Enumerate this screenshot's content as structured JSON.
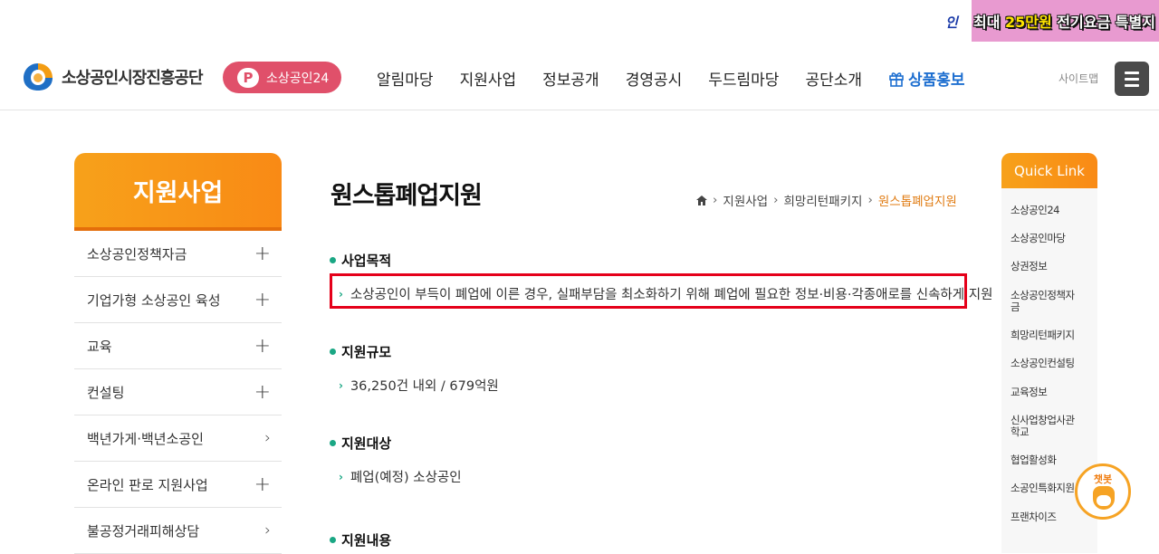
{
  "topbar": {
    "banner_icon": "인",
    "banner_prefix": "최대 ",
    "banner_highlight": "25만원",
    "banner_suffix": " 전기요금 특별지"
  },
  "header": {
    "logo_text": "소상공인시장진흥공단",
    "pill_label": "소상공인24",
    "nav": [
      "알림마당",
      "지원사업",
      "정보공개",
      "경영공시",
      "두드림마당",
      "공단소개"
    ],
    "promo_label": "상품홍보",
    "sitemap_label": "사이트맵"
  },
  "sidebar": {
    "title": "지원사업",
    "items": [
      {
        "label": "소상공인정책자금",
        "symbol": "+"
      },
      {
        "label": "기업가형 소상공인 육성",
        "symbol": "+"
      },
      {
        "label": "교육",
        "symbol": "+"
      },
      {
        "label": "컨설팅",
        "symbol": "+"
      },
      {
        "label": "백년가게·백년소공인",
        "symbol": "›"
      },
      {
        "label": "온라인 판로 지원사업",
        "symbol": "+"
      },
      {
        "label": "불공정거래피해상담",
        "symbol": "›"
      }
    ]
  },
  "content": {
    "title": "원스톱폐업지원",
    "breadcrumb": [
      "지원사업",
      "희망리턴패키지",
      "원스톱폐업지원"
    ],
    "sections": [
      {
        "heading": "사업목적",
        "body": "소상공인이 부득이 폐업에 이른 경우, 실패부담을 최소화하기 위해 폐업에 필요한 정보·비용·각종애로를 신속하게 지원"
      },
      {
        "heading": "지원규모",
        "body": "36,250건 내외 / 679억원"
      },
      {
        "heading": "지원대상",
        "body": "폐업(예정) 소상공인"
      },
      {
        "heading": "지원내용",
        "body": ""
      }
    ]
  },
  "quicklink": {
    "title": "Quick Link",
    "items": [
      "소상공인24",
      "소상공인마당",
      "상권정보",
      "소상공인정책자금",
      "희망리턴패키지",
      "소상공인컨설팅",
      "교육정보",
      "신사업창업사관학교",
      "협업활성화",
      "소공인특화지원",
      "프랜차이즈"
    ]
  },
  "chatbot": {
    "label": "챗봇"
  },
  "colors": {
    "accent": "#f98a15",
    "green": "#1aa784",
    "pill": "#e0506a",
    "highlight": "#e5001a"
  }
}
